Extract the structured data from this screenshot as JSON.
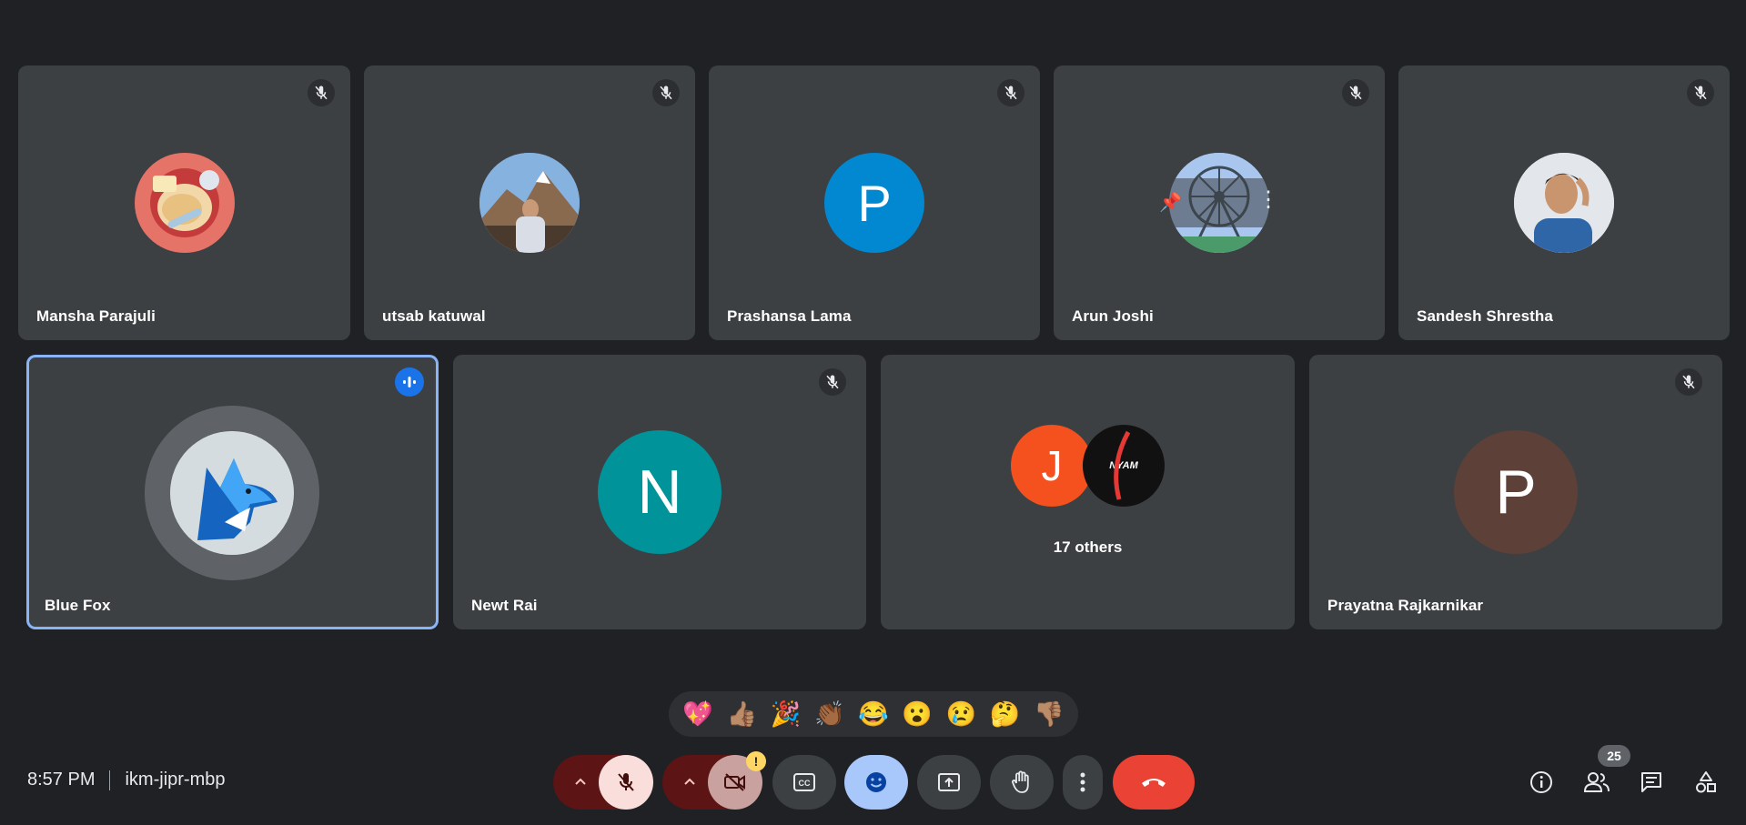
{
  "participants_row1": [
    {
      "name": "Mansha Parajuli",
      "avatar": "food-plate-avatar",
      "muted": true
    },
    {
      "name": "utsab katuwal",
      "avatar": "mountain-photo-avatar",
      "muted": true
    },
    {
      "name": "Prashansa Lama",
      "avatar": "letter-avatar",
      "initial": "P",
      "color": "#0288d1",
      "muted": true
    },
    {
      "name": "Arun Joshi",
      "avatar": "ferris-wheel-avatar",
      "muted": true
    },
    {
      "name": "Sandesh Shrestha",
      "avatar": "person-photo-avatar",
      "muted": true
    }
  ],
  "participants_row2": [
    {
      "name": "Blue Fox",
      "avatar": "wolf-logo-avatar",
      "speaking": true
    },
    {
      "name": "Newt Rai",
      "avatar": "letter-avatar",
      "initial": "N",
      "color": "#00939a",
      "muted": true
    },
    {
      "others_label": "17 others",
      "initials": [
        "J"
      ],
      "colors": [
        "#f4511e",
        "#111111"
      ],
      "logo_text": "NYAM"
    },
    {
      "name": "Prayatna Rajkarnikar",
      "avatar": "letter-avatar",
      "initial": "P",
      "color": "#5d4037",
      "muted": true
    }
  ],
  "reactions": [
    "💖",
    "👍🏽",
    "🎉",
    "👏🏾",
    "😂",
    "😮",
    "😢",
    "🤔",
    "👎🏽"
  ],
  "meeting": {
    "time": "8:57 PM",
    "code": "ikm-jipr-mbp"
  },
  "controls": {
    "camera_warning": "!",
    "people_count": "25"
  },
  "colors": {
    "background": "#202124",
    "tile": "#3c4043",
    "end_call": "#ea4335",
    "active_border": "#8ab4f8",
    "mic_off": "#f9dedc",
    "reactions_active": "#a8c7fa"
  }
}
